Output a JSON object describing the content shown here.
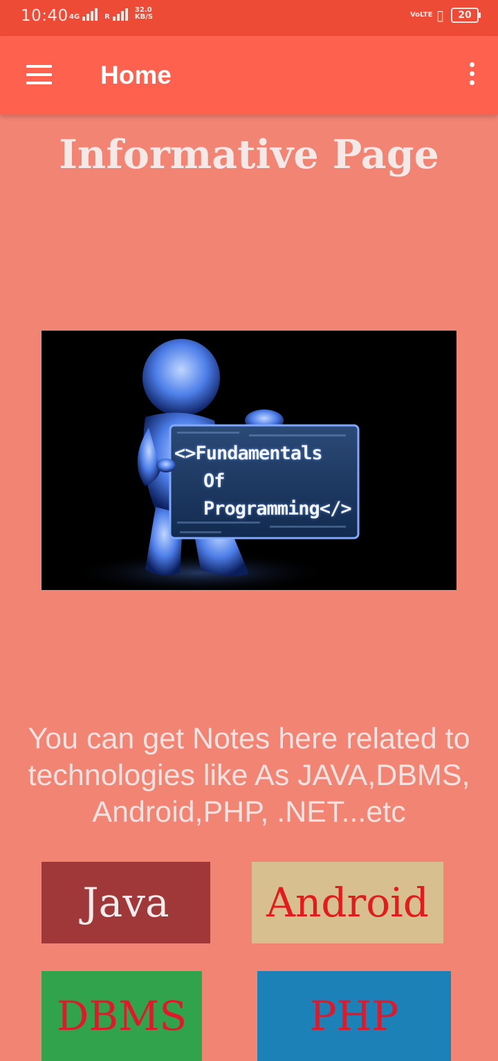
{
  "status_bar": {
    "time": "10:40",
    "network_1": "4G",
    "network_2": "R",
    "speed": "32.0 KB/S",
    "volte": "VoLTE",
    "battery": "20"
  },
  "app_bar": {
    "title": "Home",
    "menu_icon": "hamburger-menu-icon",
    "overflow_icon": "more-vertical-icon"
  },
  "page": {
    "heading": "Informative Page",
    "hero_caption_line1": "<>Fundamentals",
    "hero_caption_line2": "Of",
    "hero_caption_line3": "Programming</>",
    "intro_text": "You can get Notes here related to technologies like As JAVA,DBMS, Android,PHP, .NET...etc"
  },
  "tech_buttons": [
    {
      "label": "Java",
      "bg": "#a0383a",
      "color": "#f5ecec"
    },
    {
      "label": "Android",
      "bg": "#d8bf8f",
      "color": "#e41b1b"
    },
    {
      "label": "DBMS",
      "bg": "#31a34d",
      "color": "#e0192a"
    },
    {
      "label": "PHP",
      "bg": "#1b81b7",
      "color": "#e0192a"
    }
  ],
  "colors": {
    "status_bar": "#ee4b36",
    "app_bar": "#fe624e",
    "background": "#f28474"
  }
}
